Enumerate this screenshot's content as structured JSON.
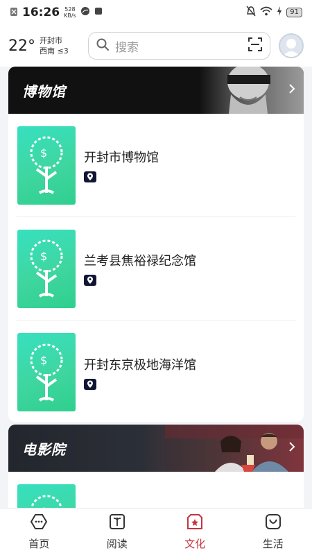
{
  "status_bar": {
    "time": "16:26",
    "net_speed_value": "528",
    "net_speed_unit": "KB/s",
    "battery": "91"
  },
  "header": {
    "temperature": "22°",
    "city": "开封市",
    "wind": "西南 ≤3",
    "search_placeholder": "搜索"
  },
  "sections": {
    "museum": {
      "title": "博物馆",
      "items": [
        {
          "name": "开封市博物馆"
        },
        {
          "name": "兰考县焦裕禄纪念馆"
        },
        {
          "name": "开封东京极地海洋馆"
        }
      ]
    },
    "cinema": {
      "title": "电影院"
    }
  },
  "nav": {
    "items": [
      {
        "label": "首页",
        "icon": "home-icon"
      },
      {
        "label": "阅读",
        "icon": "book-icon"
      },
      {
        "label": "文化",
        "icon": "culture-icon"
      },
      {
        "label": "生活",
        "icon": "life-icon"
      }
    ],
    "active_index": 2,
    "active_color": "#c5343f"
  }
}
